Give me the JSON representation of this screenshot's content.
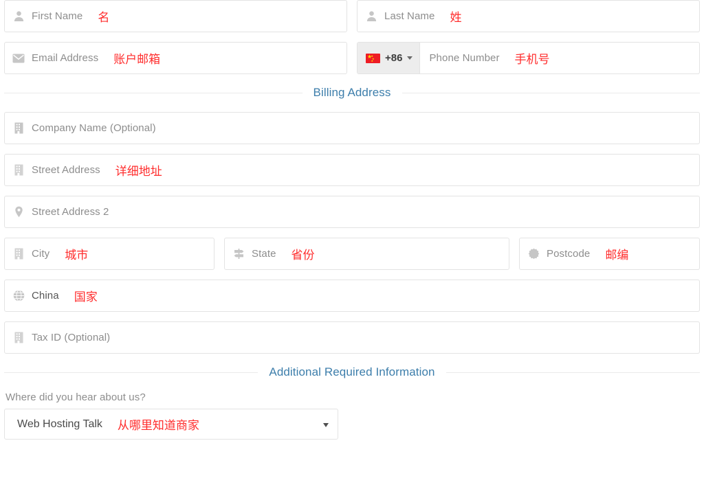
{
  "form": {
    "identity_row": [
      {
        "name": "first-name",
        "icon": "user-icon",
        "placeholder": "First Name",
        "value": "",
        "annotation": "名"
      },
      {
        "name": "last-name",
        "icon": "user-icon",
        "placeholder": "Last Name",
        "value": "",
        "annotation": "姓"
      }
    ],
    "contact_row": {
      "email": {
        "name": "email-address",
        "icon": "envelope-icon",
        "placeholder": "Email Address",
        "value": "",
        "annotation": "账户邮箱"
      },
      "phone": {
        "name": "phone-number",
        "country_flag": "china-flag-icon",
        "country_code": "+86",
        "dropdown_icon": "caret-down-icon",
        "placeholder": "Phone Number",
        "value": "",
        "annotation": "手机号"
      }
    },
    "billing_section": {
      "title": "Billing Address",
      "fields": [
        {
          "name": "company-name",
          "icon": "building-icon",
          "placeholder": "Company Name (Optional)",
          "value": "",
          "annotation": ""
        },
        {
          "name": "street-address",
          "icon": "building-icon",
          "placeholder": "Street Address",
          "value": "",
          "annotation": "详细地址"
        },
        {
          "name": "street-address-2",
          "icon": "map-pin-icon",
          "placeholder": "Street Address 2",
          "value": "",
          "annotation": ""
        }
      ],
      "city_state_postcode": [
        {
          "name": "city",
          "icon": "building-icon",
          "placeholder": "City",
          "value": "",
          "annotation": "城市"
        },
        {
          "name": "state",
          "icon": "map-signs-icon",
          "placeholder": "State",
          "value": "",
          "annotation": "省份"
        },
        {
          "name": "postcode",
          "icon": "certificate-icon",
          "placeholder": "Postcode",
          "value": "",
          "annotation": "邮编"
        }
      ],
      "country": {
        "name": "country",
        "icon": "globe-icon",
        "placeholder": "China",
        "value": "China",
        "annotation": "国家"
      },
      "tax_id": {
        "name": "tax-id",
        "icon": "building-icon",
        "placeholder": "Tax ID (Optional)",
        "value": "",
        "annotation": ""
      }
    },
    "additional_section": {
      "title": "Additional Required Information",
      "question_label": "Where did you hear about us?",
      "select": {
        "name": "hear-about-us-select",
        "selected": "Web Hosting Talk",
        "arrow_icon": "caret-down-icon",
        "annotation": "从哪里知道商家"
      }
    }
  },
  "colors": {
    "section_title": "#3d7eab",
    "annotation_red": "#ff2d2d",
    "placeholder_gray": "#8d8d8d",
    "border_gray": "#e3e3e3",
    "flag_red": "#ee1c25",
    "flag_star": "#ffde00"
  }
}
